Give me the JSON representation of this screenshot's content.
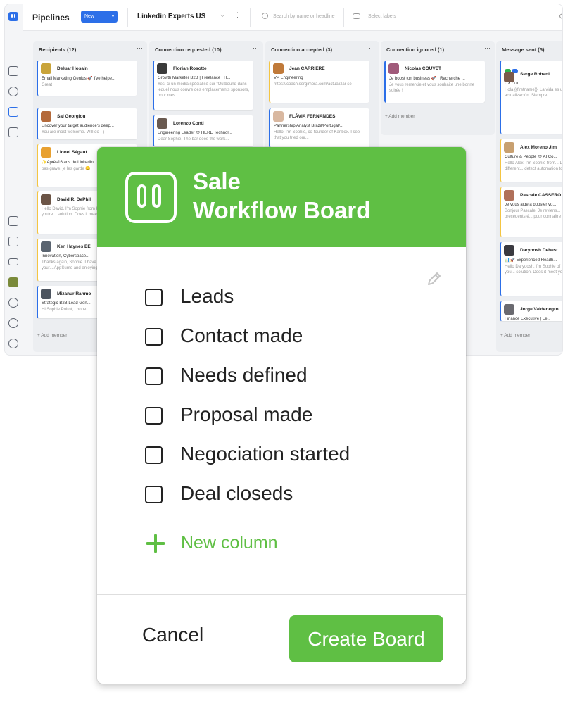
{
  "topbar": {
    "title": "Pipelines",
    "new_label": "New",
    "board_name": "Linkedin Experts US",
    "search_placeholder": "Search by name or headline",
    "labels_placeholder": "Select labels"
  },
  "columns": [
    {
      "header": "Recipients (12)",
      "cards": [
        {
          "name": "Deluar Hosain",
          "role": "Email Marketing Genius 🚀 I've helpe...",
          "msg": "Great",
          "accent": "blue",
          "avatar": "#c9a43a"
        },
        {
          "name": "Sal Georgiou",
          "role": "Uncover your target audience's deep...",
          "msg": "You are most welcome. Will do :-)",
          "accent": "blue",
          "avatar": "#b46a3b"
        },
        {
          "name": "Lionel Ségaut",
          "role": "✨Après16 ans de LinkedIn...",
          "msg": "pas grave, je les garde 😊",
          "accent": "yellow",
          "avatar": "#e8a030"
        },
        {
          "name": "David R. DePhil",
          "role": "",
          "msg": "Hello David, I'm Sophie from Kanbox. I see that you're... solution. Does it meet your...",
          "accent": "yellow",
          "avatar": "#6b5446"
        },
        {
          "name": "Ken Haynes EE,",
          "role": "Innovation, Cyberspace...",
          "msg": "Thanks again, Sophie. I have purchased one of your... AppSumo and enjoying...",
          "accent": "yellow",
          "avatar": "#5a6470"
        },
        {
          "name": "Mizanur Rahmo",
          "role": "Strategic B2B Lead Gen...",
          "msg": "Hi Sophie Poirot, I hope...",
          "accent": "blue",
          "avatar": "#4d5560"
        }
      ],
      "add": "+ Add member"
    },
    {
      "header": "Connection requested (10)",
      "cards": [
        {
          "name": "Florian Rosotte",
          "role": "Growth Marketer B2B | Freelance | H...",
          "msg": "Yes, ci un média spécialisé sur \"Outbound dans lequel nous couvre des emplacements sponsors, pour mes...",
          "accent": "blue",
          "avatar": "#3a3a3a"
        },
        {
          "name": "Lorenzo Conti",
          "role": "Engineering Leader @ HERE Technol...",
          "msg": "Dear Sophie, The bar does the work...",
          "accent": "blue",
          "avatar": "#6a5a50"
        }
      ]
    },
    {
      "header": "Connection accepted (3)",
      "cards": [
        {
          "name": "Jean CARRIERE",
          "role": "VP Engineering",
          "msg": "https://coach.sergimora.com/actualizar se",
          "accent": "yellow",
          "avatar": "#c07a3a"
        },
        {
          "name": "FLÁVIA FERNANDES",
          "role": "Partnership Analyst Brazil/Portugal/...",
          "msg": "Hello, I'm Sophie, co-founder of Kanbox. I see that you tried our...",
          "accent": "blue",
          "avatar": "#d9b8a0"
        }
      ]
    },
    {
      "header": "Connection ignored (1)",
      "cards": [
        {
          "name": "Nicolas COUVET",
          "role": "Je boost ton business 🚀 | Recherche ...",
          "msg": "Je vous remercie et vous souhaite une bonne soirée !",
          "accent": "blue",
          "avatar": "#a05a7a"
        }
      ],
      "add": "+ Add member"
    },
    {
      "header": "Message sent (5)",
      "cards": [
        {
          "name": "Serge Rohani",
          "role": "UX / UI",
          "msg": "Hola {{firstname}}, La vida es un constante auto-actualización. Siempre...",
          "accent": "blue",
          "avatar": "#7a5a4a"
        },
        {
          "name": "Alex Moreno Jim",
          "role": "Culture & People @ AI Co...",
          "msg": "Hello Alex, I'm Sophie from... LinkedIn is using different... detect automation tools...",
          "accent": "yellow",
          "avatar": "#c8a070"
        },
        {
          "name": "Pascale CASSERO",
          "role": "Je vous aide à booster vo...",
          "msg": "Bonjour Pascale, Je reviens... suite à nos précédents é... pour connaître votre...",
          "accent": "yellow",
          "avatar": "#b0705a"
        },
        {
          "name": "Daryoosh Dehest",
          "role": "📊🚀 Experienced Headh...",
          "msg": "Hello Daryoosh, I'm Sophie of Kanbox. I see that you... solution. Does it meet yo...",
          "accent": "blue",
          "avatar": "#3a3a40"
        },
        {
          "name": "Jorge Valdenegro",
          "role": "Finance Executive | Le...",
          "msg": "",
          "accent": "blue",
          "avatar": "#6a6a70"
        }
      ],
      "add": "+ Add member"
    }
  ],
  "modal": {
    "title_line1": "Sale",
    "title_line2": "Workflow Board",
    "items": [
      "Leads",
      "Contact made",
      "Needs defined",
      "Proposal made",
      "Negociation started",
      "Deal closeds"
    ],
    "new_column": "New column",
    "cancel": "Cancel",
    "create": "Create Board"
  },
  "colors": {
    "accent_green": "#5fbf44",
    "brand_blue": "#2c6fe8",
    "card_yellow": "#f4c542"
  }
}
